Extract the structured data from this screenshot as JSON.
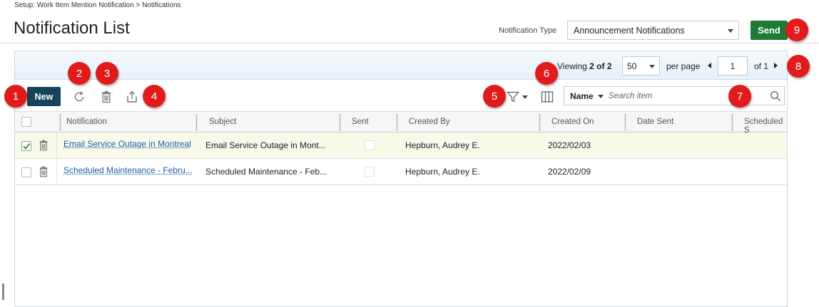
{
  "breadcrumb": "Setup: Work Item Mention Notification > Notifications",
  "page_title": "Notification List",
  "notification_type": {
    "label": "Notification Type",
    "value": "Announcement Notifications"
  },
  "send_label": "Send",
  "pagination": {
    "viewing_prefix": "Viewing",
    "viewing_count": "2 of 2",
    "per_page_value": "50",
    "per_page_label": "per page",
    "current_page": "1",
    "of_label": "of 1"
  },
  "toolbar": {
    "new_label": "New",
    "refresh_icon": "refresh-icon",
    "delete_icon": "trash-icon",
    "export_icon": "export-icon",
    "filter_icon": "filter-icon",
    "columns_icon": "columns-icon",
    "search_field": "Name",
    "search_placeholder": "Search item"
  },
  "columns": [
    "Notification",
    "Subject",
    "Sent",
    "Created By",
    "Created On",
    "Date Sent",
    "Scheduled S"
  ],
  "rows": [
    {
      "notification": "Email Service Outage in Montreal",
      "subject": "Email Service Outage in Mont...",
      "created_by": "Hepburn, Audrey E.",
      "created_on": "2022/02/03",
      "date_sent": "",
      "selected": true
    },
    {
      "notification": "Scheduled Maintenance - Febru...",
      "subject": "Scheduled Maintenance - Feb...",
      "created_by": "Hepburn, Audrey E.",
      "created_on": "2022/02/09",
      "date_sent": "",
      "selected": false
    }
  ],
  "markers": [
    "1",
    "2",
    "3",
    "4",
    "5",
    "6",
    "7",
    "8",
    "9"
  ],
  "colors": {
    "send": "#1e7a34",
    "new": "#16435a",
    "marker": "#e11b1b",
    "link": "#1d5fa8",
    "selected_row": "#f7f9e9"
  }
}
